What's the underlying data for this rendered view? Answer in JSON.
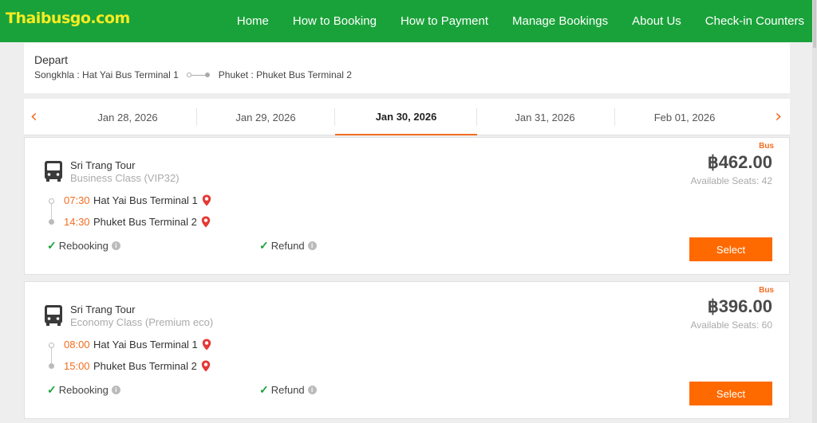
{
  "header": {
    "logo": "Thaibusgo.com",
    "nav": [
      "Home",
      "How to Booking",
      "How to Payment",
      "Manage Bookings",
      "About Us",
      "Check-in Counters"
    ]
  },
  "depart": {
    "title": "Depart",
    "from": "Songkhla : Hat Yai Bus Terminal 1",
    "to": "Phuket : Phuket Bus Terminal 2"
  },
  "dates": {
    "items": [
      "Jan 28, 2026",
      "Jan 29, 2026",
      "Jan 30, 2026",
      "Jan 31, 2026",
      "Feb 01, 2026"
    ],
    "selected": "Jan 30, 2026",
    "prev_icon": "chevron-left-icon",
    "next_icon": "chevron-right-icon"
  },
  "trips": [
    {
      "operator": "Sri Trang Tour",
      "class": "Business Class (VIP32)",
      "type": "Bus",
      "price": "฿462.00",
      "seats": "Available Seats: 42",
      "depart_time": "07:30",
      "depart_place": "Hat Yai Bus Terminal 1",
      "arrive_time": "14:30",
      "arrive_place": "Phuket Bus Terminal 2",
      "feature1": "Rebooking",
      "feature2": "Refund",
      "select_label": "Select"
    },
    {
      "operator": "Sri Trang Tour",
      "class": "Economy Class (Premium eco)",
      "type": "Bus",
      "price": "฿396.00",
      "seats": "Available Seats: 60",
      "depart_time": "08:00",
      "depart_place": "Hat Yai Bus Terminal 1",
      "arrive_time": "15:00",
      "arrive_place": "Phuket Bus Terminal 2",
      "feature1": "Rebooking",
      "feature2": "Refund",
      "select_label": "Select"
    }
  ],
  "colors": {
    "header_green": "#1aa23a",
    "logo_yellow": "#f6ec21",
    "accent_orange": "#f26d21",
    "button_orange": "#ff6a00",
    "pin_red": "#e53935"
  }
}
